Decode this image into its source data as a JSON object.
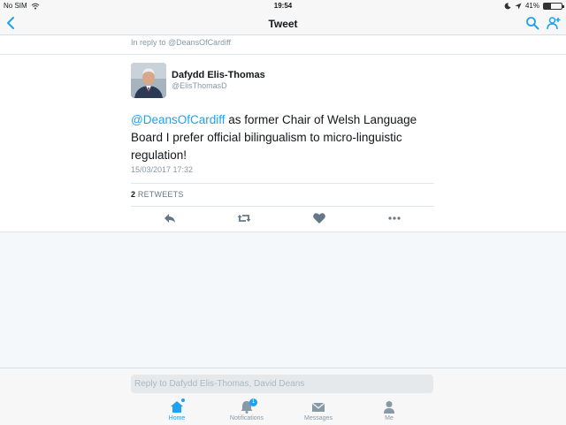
{
  "statusbar": {
    "carrier": "No SIM",
    "time": "19:54",
    "battery_percent": "41%",
    "battery_level": 0.41,
    "icons": [
      "wifi-icon",
      "moon-icon",
      "location-arrow-icon",
      "battery-icon"
    ]
  },
  "navbar": {
    "title": "Tweet",
    "back_icon": "chevron-left-icon",
    "right_icons": [
      "search-icon",
      "add-person-icon"
    ]
  },
  "tweet": {
    "reply_context": "In reply to @DeansOfCardiff",
    "author_name": "Dafydd Elis-Thomas",
    "author_handle": "@ElisThomasD",
    "mention": "@DeansOfCardiff",
    "text_rest": " as former Chair of Welsh Language Board I prefer official bilingualism to micro-linguistic regulation!",
    "timestamp": "15/03/2017 17:32",
    "retweet_count": "2",
    "retweet_label": "RETWEETS",
    "actions": [
      "reply-icon",
      "retweet-icon",
      "like-icon",
      "more-icon"
    ]
  },
  "compose": {
    "placeholder": "Reply to Dafydd Elis-Thomas, David Deans"
  },
  "tabs": [
    {
      "label": "Home",
      "icon": "home-icon",
      "active": true
    },
    {
      "label": "Notifications",
      "icon": "bell-icon",
      "badge": "1"
    },
    {
      "label": "Messages",
      "icon": "envelope-icon"
    },
    {
      "label": "Me",
      "icon": "person-icon"
    }
  ],
  "colors": {
    "accent": "#1da1f2",
    "muted": "#8899a6",
    "background": "#f5f8fa"
  }
}
